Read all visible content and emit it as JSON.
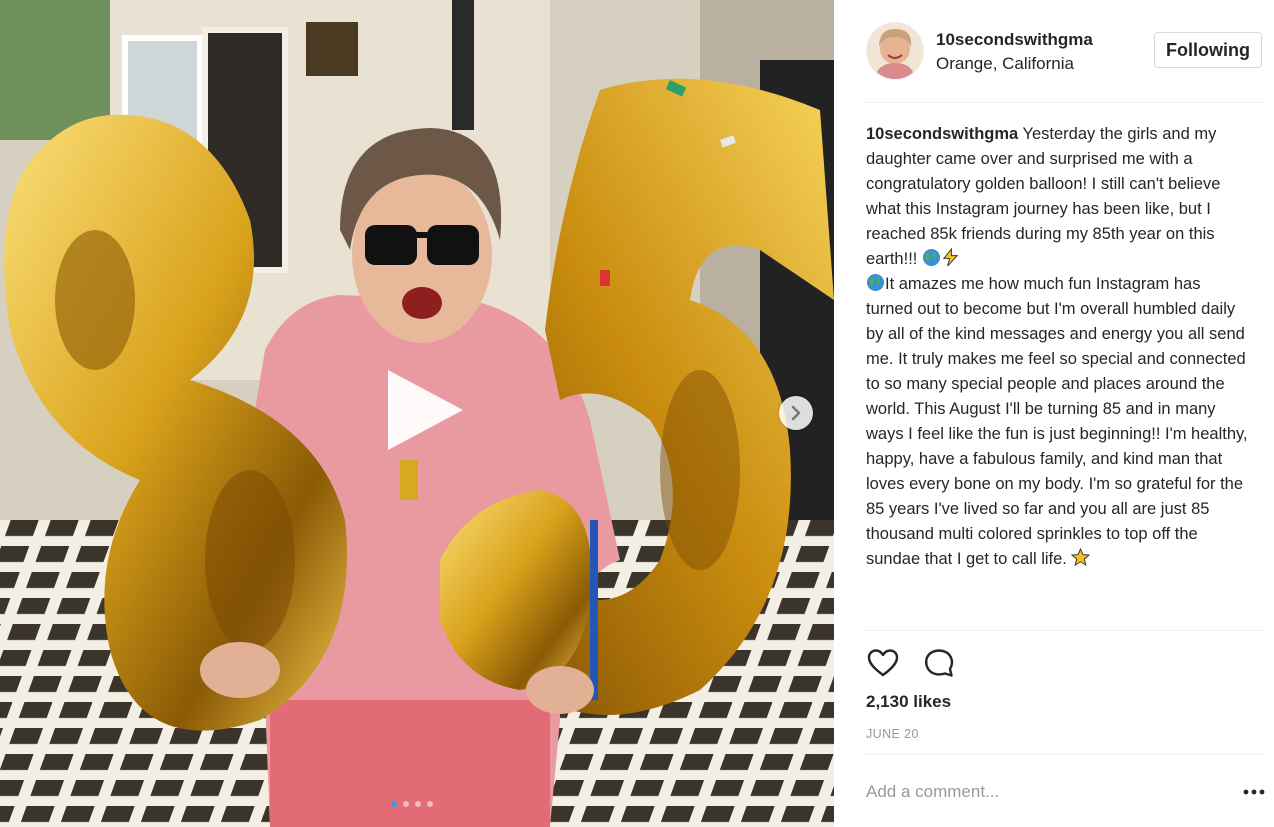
{
  "post": {
    "username": "10secondswithgma",
    "location": "Orange, California",
    "follow_label": "Following",
    "caption_user": "10secondswithgma",
    "caption_part1": " Yesterday the girls and my daughter came over and surprised me with a congratulatory golden balloon! I still can't believe what this Instagram journey has been like, but I reached 85k friends during my 85th year on this earth!!! ",
    "caption_part2": "It amazes me how much fun Instagram has turned out to become but I'm overall humbled daily by all of the kind messages and energy you all send me. It truly makes me feel so special and connected to so many special people and places around the world. This August I'll be turning 85 and in many ways I feel like the fun is just beginning!! I'm healthy, happy, have a fabulous family, and kind man that loves every bone on my body. I'm so grateful for the 85 years I've lived so far and you all are just 85 thousand multi colored sprinkles to top off the sundae that I get to call life. ",
    "likes": "2,130 likes",
    "date": "JUNE 20",
    "comment_placeholder": "Add a comment...",
    "carousel": {
      "count": 4,
      "active": 0
    }
  },
  "icons": {
    "globe": "globe-emoji",
    "bolt": "high-voltage-emoji",
    "star": "star-emoji",
    "like": "heart-icon",
    "comment": "comment-icon",
    "play": "play-icon",
    "next": "chevron-right-icon",
    "more": "more-icon"
  },
  "colors": {
    "balloon_gold": "#d9a21b",
    "shirt_pink": "#e99aa0",
    "carousel_active": "#3897f0",
    "muted_text": "#999999"
  }
}
